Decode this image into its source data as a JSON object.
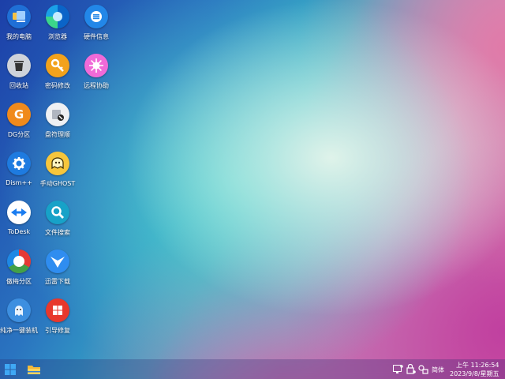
{
  "desktop": {
    "icons": [
      {
        "label": "我的电脑",
        "icon": "this-pc-icon"
      },
      {
        "label": "浏览器",
        "icon": "edge-browser-icon"
      },
      {
        "label": "硬件信息",
        "icon": "hardware-info-icon"
      },
      {
        "label": "回收站",
        "icon": "recycle-bin-icon"
      },
      {
        "label": "密码修改",
        "icon": "key-icon"
      },
      {
        "label": "远程协助",
        "icon": "remote-assist-icon"
      },
      {
        "label": "DG分区",
        "icon": "diskgenius-icon"
      },
      {
        "label": "盘符理顺",
        "icon": "drive-letter-icon"
      },
      {
        "label": "Dism++",
        "icon": "gear-icon"
      },
      {
        "label": "手动GHOST",
        "icon": "ghost-icon"
      },
      {
        "label": "ToDesk",
        "icon": "todesk-icon"
      },
      {
        "label": "文件搜索",
        "icon": "search-icon"
      },
      {
        "label": "傲梅分区",
        "icon": "aomei-partition-icon"
      },
      {
        "label": "迅雷下载",
        "icon": "thunder-download-icon"
      },
      {
        "label": "纯净一键装机",
        "icon": "one-click-install-icon"
      },
      {
        "label": "引导修复",
        "icon": "boot-repair-icon"
      }
    ]
  },
  "taskbar": {
    "start_icon": "windows-start-icon",
    "pinned": [
      "file-explorer-icon"
    ],
    "tray": {
      "ime": "简体",
      "time": "上午 11:26:54",
      "date": "2023/9/8/星期五"
    }
  }
}
